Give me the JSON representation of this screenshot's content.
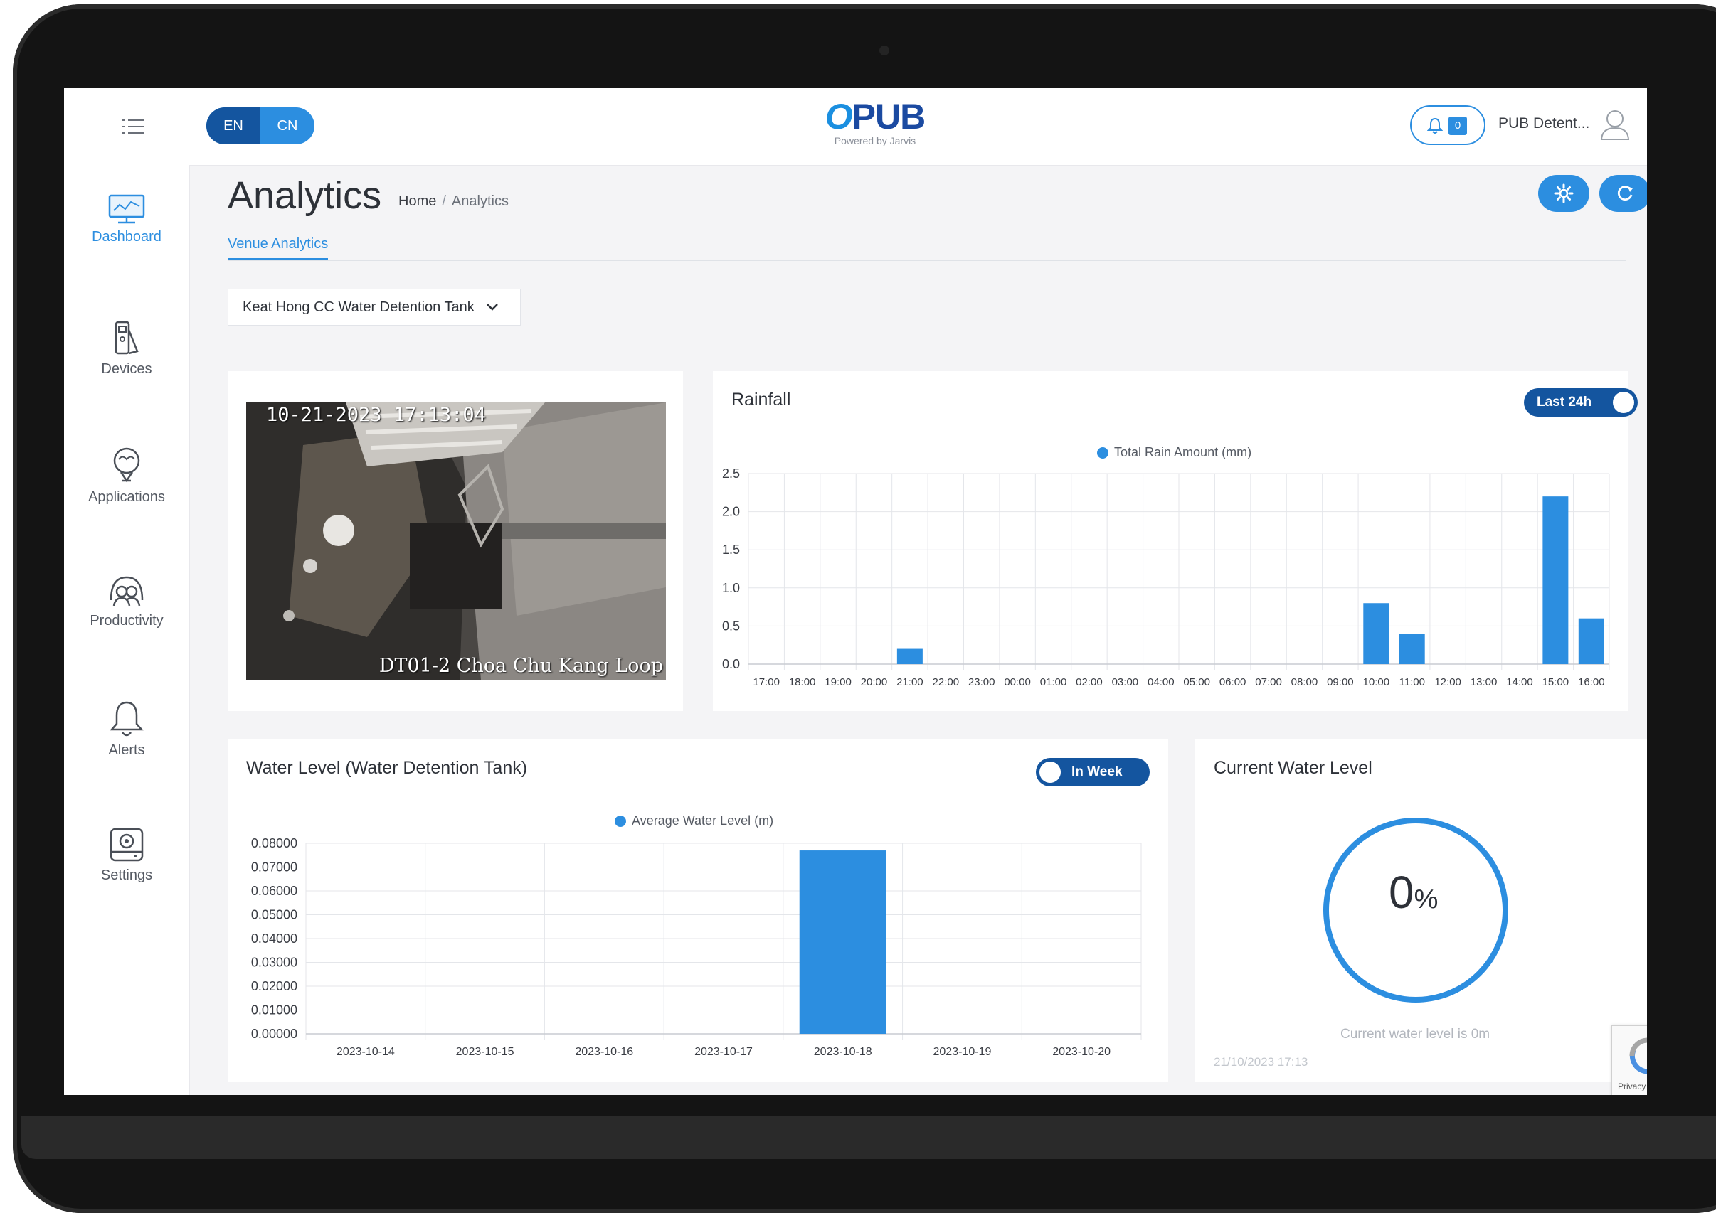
{
  "header": {
    "lang": [
      "EN",
      "CN"
    ],
    "logo": "PUB",
    "logo_sub": "Powered by Jarvis",
    "notification_count": "0",
    "user_name": "PUB Detent..."
  },
  "sidebar": {
    "items": [
      {
        "label": "Dashboard",
        "icon": "monitor-icon",
        "active": true
      },
      {
        "label": "Devices",
        "icon": "devices-icon"
      },
      {
        "label": "Applications",
        "icon": "bulb-icon"
      },
      {
        "label": "Productivity",
        "icon": "people-icon"
      },
      {
        "label": "Alerts",
        "icon": "bell-icon"
      },
      {
        "label": "Settings",
        "icon": "settings-device-icon"
      }
    ]
  },
  "page": {
    "title": "Analytics",
    "breadcrumb_home": "Home",
    "breadcrumb_sep": "/",
    "breadcrumb_current": "Analytics",
    "tab": "Venue Analytics",
    "venue": "Keat Hong CC Water Detention Tank"
  },
  "camera": {
    "timestamp": "10-21-2023 17:13:04",
    "label": "DT01-2 Choa Chu Kang Loop"
  },
  "rainfall": {
    "title": "Rainfall",
    "toggle": "Last 24h"
  },
  "water_level": {
    "title": "Water Level (Water Detention Tank)",
    "toggle": "In Week"
  },
  "current_level": {
    "title": "Current Water Level",
    "value": "0",
    "unit": "%",
    "caption": "Current water level is 0m",
    "timestamp": "21/10/2023 17:13"
  },
  "recaptcha": "Privacy - Terms",
  "colors": {
    "accent": "#2c8ee0",
    "dark_accent": "#14559f",
    "bar": "#2c8ee0"
  },
  "chart_data": [
    {
      "type": "bar",
      "title": "Rainfall",
      "legend": "Total Rain Amount (mm)",
      "categories": [
        "17:00",
        "18:00",
        "19:00",
        "20:00",
        "21:00",
        "22:00",
        "23:00",
        "00:00",
        "01:00",
        "02:00",
        "03:00",
        "04:00",
        "05:00",
        "06:00",
        "07:00",
        "08:00",
        "09:00",
        "10:00",
        "11:00",
        "12:00",
        "13:00",
        "14:00",
        "15:00",
        "16:00"
      ],
      "values": [
        0,
        0,
        0,
        0,
        0.2,
        0,
        0,
        0,
        0,
        0,
        0,
        0,
        0,
        0,
        0,
        0,
        0,
        0.8,
        0.4,
        0,
        0,
        0,
        2.2,
        0.6
      ],
      "yticks": [
        "0.0",
        "0.5",
        "1.0",
        "1.5",
        "2.0",
        "2.5"
      ],
      "ylim": [
        0,
        2.5
      ],
      "grid": true,
      "legend_position": "top"
    },
    {
      "type": "bar",
      "title": "Water Level (Water Detention Tank)",
      "legend": "Average Water Level (m)",
      "categories": [
        "2023-10-14",
        "2023-10-15",
        "2023-10-16",
        "2023-10-17",
        "2023-10-18",
        "2023-10-19",
        "2023-10-20"
      ],
      "values": [
        0,
        0,
        0,
        0,
        0.077,
        0,
        0
      ],
      "yticks": [
        "0.00000",
        "0.01000",
        "0.02000",
        "0.03000",
        "0.04000",
        "0.05000",
        "0.06000",
        "0.07000",
        "0.08000"
      ],
      "ylim": [
        0,
        0.08
      ],
      "grid": true,
      "legend_position": "top"
    }
  ]
}
